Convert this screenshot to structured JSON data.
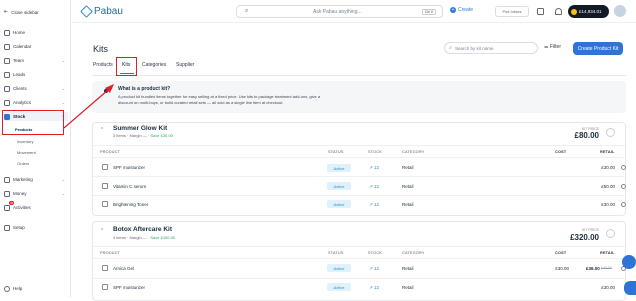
{
  "sidebar": {
    "close_label": "Close sidebar",
    "items": [
      {
        "label": "Home",
        "icon": "home-icon"
      },
      {
        "label": "Calendar",
        "icon": "calendar-icon"
      },
      {
        "label": "Team",
        "icon": "team-icon"
      },
      {
        "label": "Leads",
        "icon": "leads-icon"
      },
      {
        "label": "Clients",
        "icon": "clients-icon"
      },
      {
        "label": "Analytics",
        "icon": "analytics-icon"
      },
      {
        "label": "Stock",
        "icon": "stock-icon"
      },
      {
        "label": "Marketing",
        "icon": "marketing-icon"
      },
      {
        "label": "Money",
        "icon": "money-icon"
      },
      {
        "label": "Activities",
        "icon": "activities-icon",
        "badge": "32"
      },
      {
        "label": "Setup",
        "icon": "setup-icon"
      },
      {
        "label": "Help",
        "icon": "help-icon"
      }
    ],
    "stock_sub": [
      "Products",
      "Inventory",
      "Movement",
      "Orders"
    ]
  },
  "topbar": {
    "brand": "Pabau",
    "search_placeholder": "Ask Pabau anything...",
    "search_kbd": "Ctrl K",
    "create_label": "Create",
    "pax_label": "Pax Infoes",
    "coins": "£14,934.01"
  },
  "page": {
    "title": "Kits",
    "search_placeholder": "Search by kit name",
    "filter_label": "Filter",
    "create_kit_label": "Create Product Kit",
    "tabs": [
      "Products",
      "Kits",
      "Categories",
      "Supplier"
    ]
  },
  "info": {
    "title": "What is a product kit?",
    "text": "A product kit bundles items together for easy selling at a fixed price. Use kits to package treatment add-ons, give a discount on multi-buys, or build curated retail sets — all sold as a single line item at checkout."
  },
  "table_headers": [
    "PRODUCT",
    "STATUS",
    "STOCK",
    "CATEGORY",
    "COST",
    "RETAIL"
  ],
  "kits": [
    {
      "name": "Summer Glow Kit",
      "meta": "3 items · Margin —",
      "save": "Save £30.00",
      "price_label": "KIT PRICE",
      "price": "£80.00",
      "rows": [
        {
          "product": "SPF moisturizer",
          "status": "Active",
          "stock": "12",
          "category": "Retail",
          "cost": "",
          "retail": "£30.00",
          "strike": ""
        },
        {
          "product": "Vitamin C serum",
          "status": "Active",
          "stock": "12",
          "category": "Retail",
          "cost": "",
          "retail": "£50.00",
          "strike": ""
        },
        {
          "product": "Brightening Toner",
          "status": "Active",
          "stock": "12",
          "category": "Retail",
          "cost": "",
          "retail": "£30.00",
          "strike": ""
        }
      ]
    },
    {
      "name": "Botox Aftercare Kit",
      "meta": "4 items · Margin —",
      "save": "Save £100.00",
      "price_label": "KIT PRICE",
      "price": "£320.00",
      "rows": [
        {
          "product": "Arnica Gel",
          "status": "Active",
          "stock": "12",
          "category": "Retail",
          "cost": "£30.00",
          "retail": "£36.00",
          "strike": "£40.00"
        },
        {
          "product": "SPF moisturizer",
          "status": "Active",
          "stock": "12",
          "category": "Retail",
          "cost": "",
          "retail": "£30.00",
          "strike": ""
        }
      ]
    }
  ],
  "colors": {
    "accent": "#2d74d4",
    "highlight": "#e01e2a",
    "active_badge": "#dff1fb",
    "save": "#2aa55b"
  }
}
